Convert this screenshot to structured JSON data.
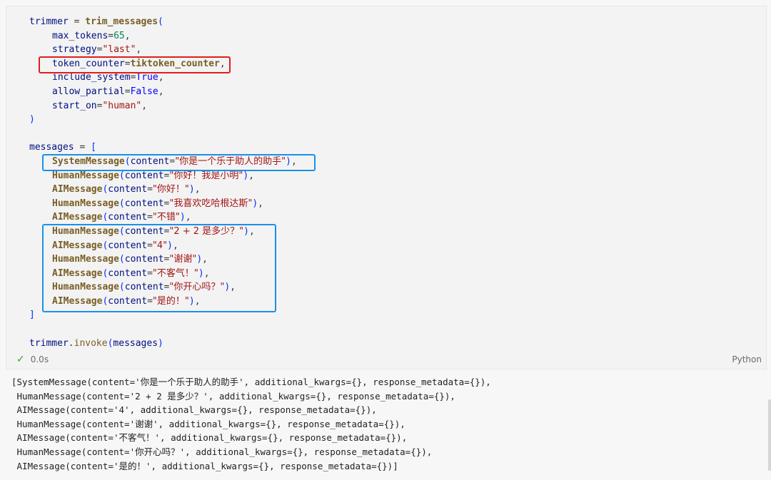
{
  "code": {
    "trimmer_var": "trimmer",
    "trim_fn": "trim_messages",
    "params": [
      {
        "name": "max_tokens",
        "value": "65",
        "kind": "num"
      },
      {
        "name": "strategy",
        "value": "\"last\"",
        "kind": "str"
      },
      {
        "name": "token_counter",
        "value": "tiktoken_counter",
        "kind": "fnref"
      },
      {
        "name": "include_system",
        "value": "True",
        "kind": "bool"
      },
      {
        "name": "allow_partial",
        "value": "False",
        "kind": "bool"
      },
      {
        "name": "start_on",
        "value": "\"human\"",
        "kind": "str"
      }
    ],
    "messages_var": "messages",
    "messages": [
      {
        "cls": "SystemMessage",
        "content": "你是一个乐于助人的助手"
      },
      {
        "cls": "HumanMessage",
        "content": "你好！我是小明"
      },
      {
        "cls": "AIMessage",
        "content": "你好！"
      },
      {
        "cls": "HumanMessage",
        "content": "我喜欢吃哈根达斯"
      },
      {
        "cls": "AIMessage",
        "content": "不错"
      },
      {
        "cls": "HumanMessage",
        "content": "2 + 2 是多少？"
      },
      {
        "cls": "AIMessage",
        "content": "4"
      },
      {
        "cls": "HumanMessage",
        "content": "谢谢"
      },
      {
        "cls": "AIMessage",
        "content": "不客气！"
      },
      {
        "cls": "HumanMessage",
        "content": "你开心吗？"
      },
      {
        "cls": "AIMessage",
        "content": "是的！"
      }
    ],
    "invoke_line": "trimmer.invoke(messages)"
  },
  "status": {
    "time": "0.0s",
    "language": "Python"
  },
  "output": {
    "lines": [
      "[SystemMessage(content='你是一个乐于助人的助手', additional_kwargs={}, response_metadata={}),",
      " HumanMessage(content='2 + 2 是多少？', additional_kwargs={}, response_metadata={}),",
      " AIMessage(content='4', additional_kwargs={}, response_metadata={}),",
      " HumanMessage(content='谢谢', additional_kwargs={}, response_metadata={}),",
      " AIMessage(content='不客气！', additional_kwargs={}, response_metadata={}),",
      " HumanMessage(content='你开心吗？', additional_kwargs={}, response_metadata={}),",
      " AIMessage(content='是的！', additional_kwargs={}, response_metadata={})]"
    ]
  },
  "colors": {
    "highlight_red": "#e11d1d",
    "highlight_blue": "#1a90e8",
    "success_check": "#3c9a3c"
  }
}
